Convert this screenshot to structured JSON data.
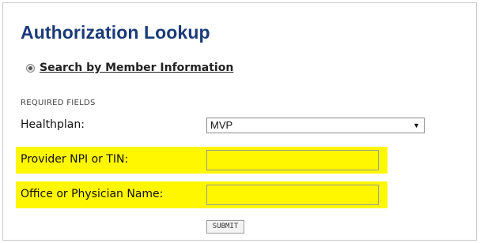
{
  "page": {
    "title": "Authorization Lookup"
  },
  "search": {
    "option_label": "Search by Member Information",
    "selected": true
  },
  "form": {
    "required_note": "REQUIRED FIELDS",
    "healthplan": {
      "label": "Healthplan:",
      "value": "MVP",
      "arrow": "▼"
    },
    "provider_npi": {
      "label": "Provider NPI or TIN:",
      "value": "",
      "placeholder": ""
    },
    "office_name": {
      "label": "Office or Physician Name:",
      "value": "",
      "placeholder": ""
    },
    "submit_label": "SUBMIT"
  },
  "colors": {
    "title": "#1a3a78",
    "highlight": "#fff700"
  }
}
